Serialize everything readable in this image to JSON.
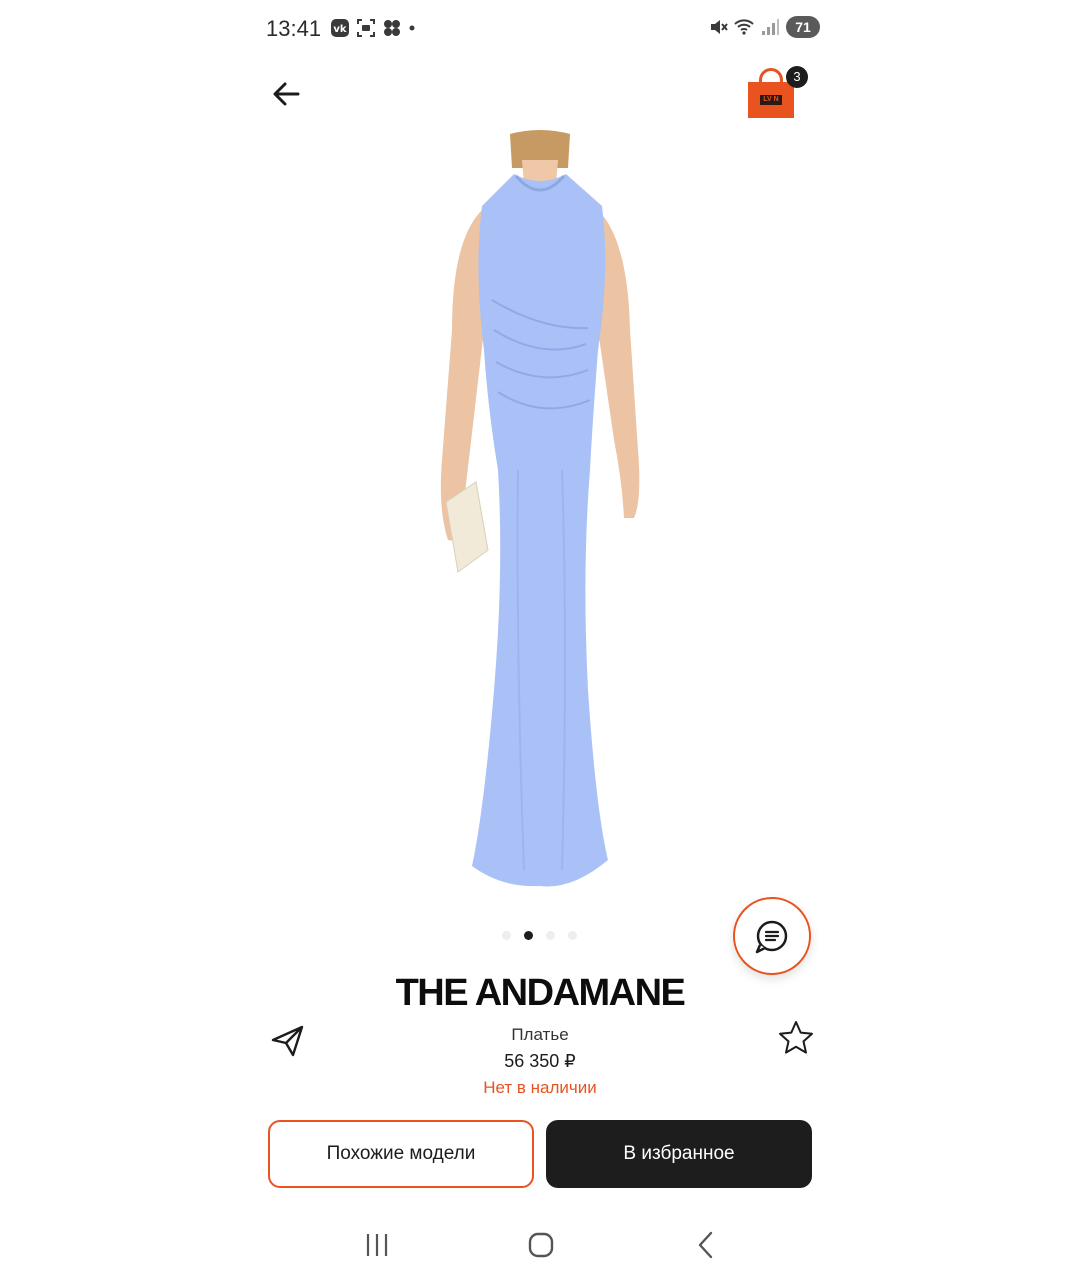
{
  "status_bar": {
    "time": "13:41",
    "battery": "71"
  },
  "header": {
    "cart_count": "3",
    "cart_logo_text": "LV N"
  },
  "gallery": {
    "total_slides": 4,
    "active_slide": 2,
    "product_color": "#a9c1f7"
  },
  "product": {
    "brand": "THE ANDAMANE",
    "type": "Платье",
    "price": "56 350 ₽",
    "availability": "Нет в наличии"
  },
  "actions": {
    "similar_label": "Похожие модели",
    "favorite_label": "В избранное"
  },
  "colors": {
    "accent": "#e8531f",
    "dark": "#1d1d1d",
    "dress": "#a9c1f7"
  }
}
